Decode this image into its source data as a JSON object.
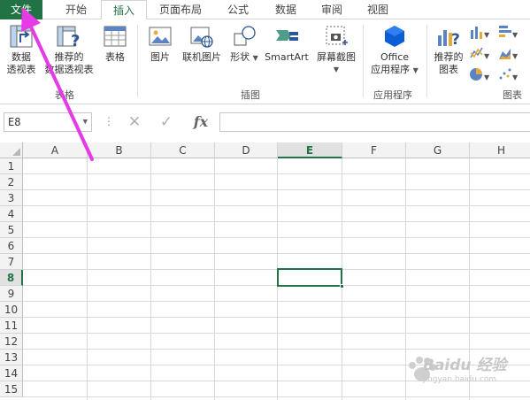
{
  "tabs": [
    "文件",
    "开始",
    "插入",
    "页面布局",
    "公式",
    "数据",
    "审阅",
    "视图"
  ],
  "active_tab": "插入",
  "ribbon": {
    "tables": {
      "pivot_line1": "数据",
      "pivot_line2": "透视表",
      "recommended_line1": "推荐的",
      "recommended_line2": "数据透视表",
      "table": "表格",
      "group_label": "表格"
    },
    "illustrations": {
      "pictures": "图片",
      "online_pictures": "联机图片",
      "shapes": "形状",
      "smartart": "SmartArt",
      "screenshot": "屏幕截图",
      "group_label": "插图"
    },
    "apps": {
      "office_line1": "Office",
      "office_line2": "应用程序",
      "group_label": "应用程序"
    },
    "charts": {
      "recommended_line1": "推荐的",
      "recommended_line2": "图表",
      "group_label": "图表"
    }
  },
  "formula_bar": {
    "name_box": "E8",
    "fx_label": "fx",
    "formula": ""
  },
  "grid": {
    "columns": [
      "A",
      "B",
      "C",
      "D",
      "E",
      "F",
      "G",
      "H"
    ],
    "rows": [
      "1",
      "2",
      "3",
      "4",
      "5",
      "6",
      "7",
      "8",
      "9",
      "10",
      "11",
      "12",
      "13",
      "14",
      "15"
    ],
    "selected_cell": "E8",
    "selected_column": "E",
    "selected_row": "8"
  },
  "colors": {
    "accent": "#217346",
    "arrow": "#e63ae6"
  },
  "watermark": {
    "text": "Baidu 经验",
    "sub": "jingyan.baidu.com"
  }
}
